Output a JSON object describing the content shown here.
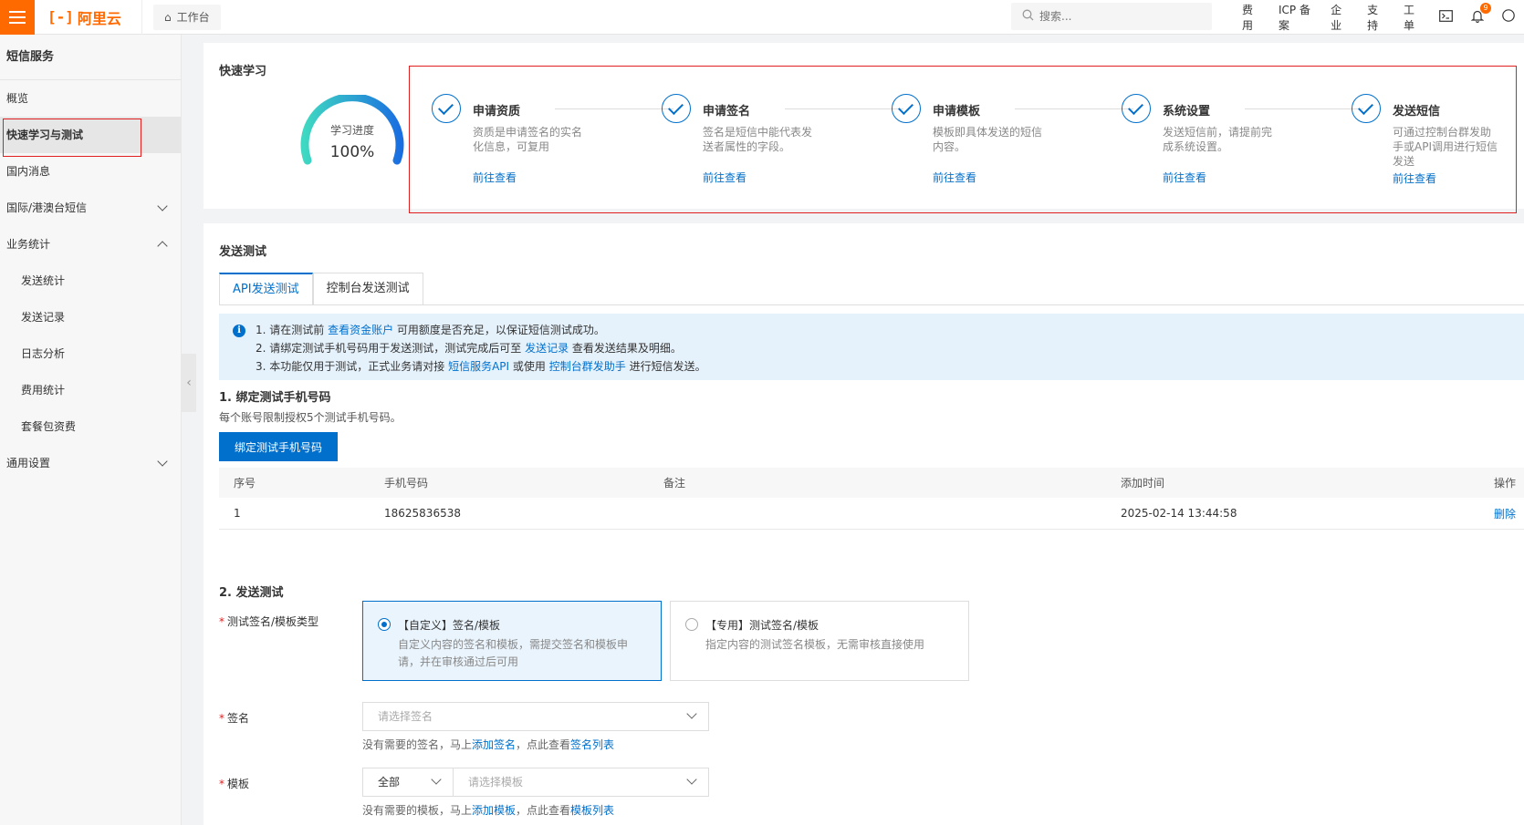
{
  "topbar": {
    "logo_mark": "[-]",
    "logo_text": "阿里云",
    "workbench": "工作台",
    "search_placeholder": "搜索...",
    "nav": [
      "费用",
      "ICP 备案",
      "企业",
      "支持",
      "工单"
    ],
    "notification_count": "9"
  },
  "sidebar": {
    "title": "短信服务",
    "items": [
      {
        "label": "概览"
      },
      {
        "label": "快速学习与测试"
      },
      {
        "label": "国内消息"
      },
      {
        "label": "国际/港澳台短信"
      },
      {
        "label": "业务统计"
      },
      {
        "label": "发送统计"
      },
      {
        "label": "发送记录"
      },
      {
        "label": "日志分析"
      },
      {
        "label": "费用统计"
      },
      {
        "label": "套餐包资费"
      },
      {
        "label": "通用设置"
      }
    ]
  },
  "quick_learn": {
    "title": "快速学习",
    "gauge_label": "学习进度",
    "gauge_value": "100%",
    "progress": 1.0,
    "steps": [
      {
        "title": "申请资质",
        "desc": "资质是申请签名的实名化信息，可复用",
        "link": "前往查看"
      },
      {
        "title": "申请签名",
        "desc": "签名是短信中能代表发送者属性的字段。",
        "link": "前往查看"
      },
      {
        "title": "申请模板",
        "desc": "模板即具体发送的短信内容。",
        "link": "前往查看"
      },
      {
        "title": "系统设置",
        "desc": "发送短信前，请提前完成系统设置。",
        "link": "前往查看"
      },
      {
        "title": "发送短信",
        "desc": "可通过控制台群发助手或API调用进行短信发送",
        "link": "前往查看"
      }
    ]
  },
  "send_test": {
    "title": "发送测试",
    "tabs": [
      "API发送测试",
      "控制台发送测试"
    ],
    "notice": {
      "line1_a": "1. 请在测试前 ",
      "line1_link": "查看资金账户",
      "line1_b": " 可用额度是否充足，以保证短信测试成功。",
      "line2_a": "2. 请绑定测试手机号码用于发送测试，测试完成后可至 ",
      "line2_link": "发送记录",
      "line2_b": " 查看发送结果及明细。",
      "line3_a": "3. 本功能仅用于测试，正式业务请对接 ",
      "line3_link1": "短信服务API",
      "line3_b": " 或使用 ",
      "line3_link2": "控制台群发助手",
      "line3_c": " 进行短信发送。"
    },
    "bind_title": "1. 绑定测试手机号码",
    "bind_sub": "每个账号限制授权5个测试手机号码。",
    "bind_button": "绑定测试手机号码",
    "table": {
      "headers": [
        "序号",
        "手机号码",
        "备注",
        "添加时间",
        "操作"
      ],
      "rows": [
        [
          "1",
          "18625836538",
          "",
          "2025-02-14 13:44:58",
          "删除"
        ]
      ]
    },
    "send_title": "2. 发送测试",
    "type_label": "测试签名/模板类型",
    "options": [
      {
        "title": "【自定义】签名/模板",
        "desc": "自定义内容的签名和模板，需提交签名和模板申请，并在审核通过后可用"
      },
      {
        "title": "【专用】测试签名/模板",
        "desc": "指定内容的测试签名模板，无需审核直接使用"
      }
    ],
    "sign_label": "签名",
    "sign_placeholder": "请选择签名",
    "sign_hint_a": "没有需要的签名，马上",
    "sign_hint_link1": "添加签名",
    "sign_hint_b": "，点此查看",
    "sign_hint_link2": "签名列表",
    "template_label": "模板",
    "template_filter": "全部",
    "template_placeholder": "请选择模板",
    "template_hint_a": "没有需要的模板，马上",
    "template_hint_link1": "添加模板",
    "template_hint_b": "，点此查看",
    "template_hint_link2": "模板列表"
  }
}
